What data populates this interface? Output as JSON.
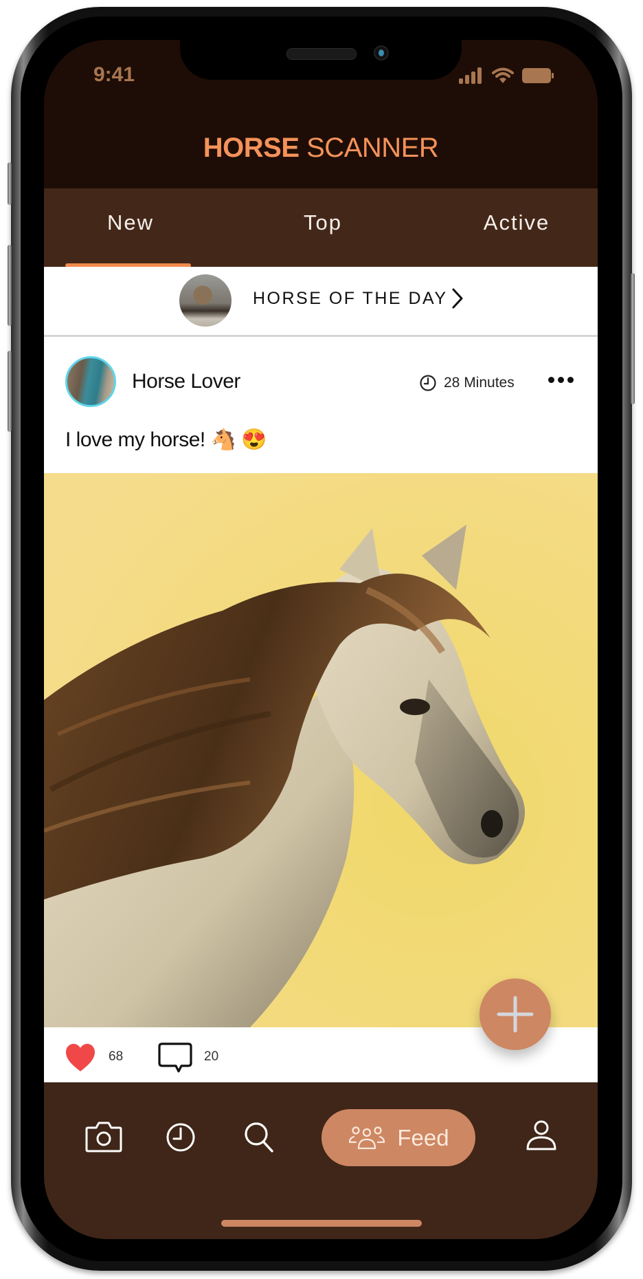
{
  "status_bar": {
    "time": "9:41",
    "icons": [
      "signal-icon",
      "wifi-icon",
      "battery-icon"
    ]
  },
  "header": {
    "title_bold": "HORSE",
    "title_regular": " SCANNER"
  },
  "tabs": [
    {
      "label": "New",
      "active": true
    },
    {
      "label": "Top",
      "active": false
    },
    {
      "label": "Active",
      "active": false
    }
  ],
  "horse_of_the_day": {
    "label": "HORSE OF THE DAY",
    "icon": "chevron-right-icon"
  },
  "post": {
    "author": "Horse Lover",
    "time_ago": "28 Minutes",
    "text": "I love my horse! 🐴 😍",
    "likes": "68",
    "comments": "20"
  },
  "fab": {
    "icon": "plus-icon"
  },
  "bottom_nav": {
    "items": [
      {
        "name": "camera",
        "icon": "camera-icon"
      },
      {
        "name": "history",
        "icon": "clock-icon"
      },
      {
        "name": "search",
        "icon": "search-icon"
      },
      {
        "name": "feed",
        "icon": "users-icon",
        "label": "Feed",
        "active": true
      },
      {
        "name": "profile",
        "icon": "user-icon"
      }
    ]
  },
  "colors": {
    "accent": "#f4925a",
    "tab_bar": "#43281a",
    "header_bg": "#1e0d06",
    "pill": "#cd8763",
    "like": "#f04848",
    "avatar_ring": "#5fd5e8"
  }
}
